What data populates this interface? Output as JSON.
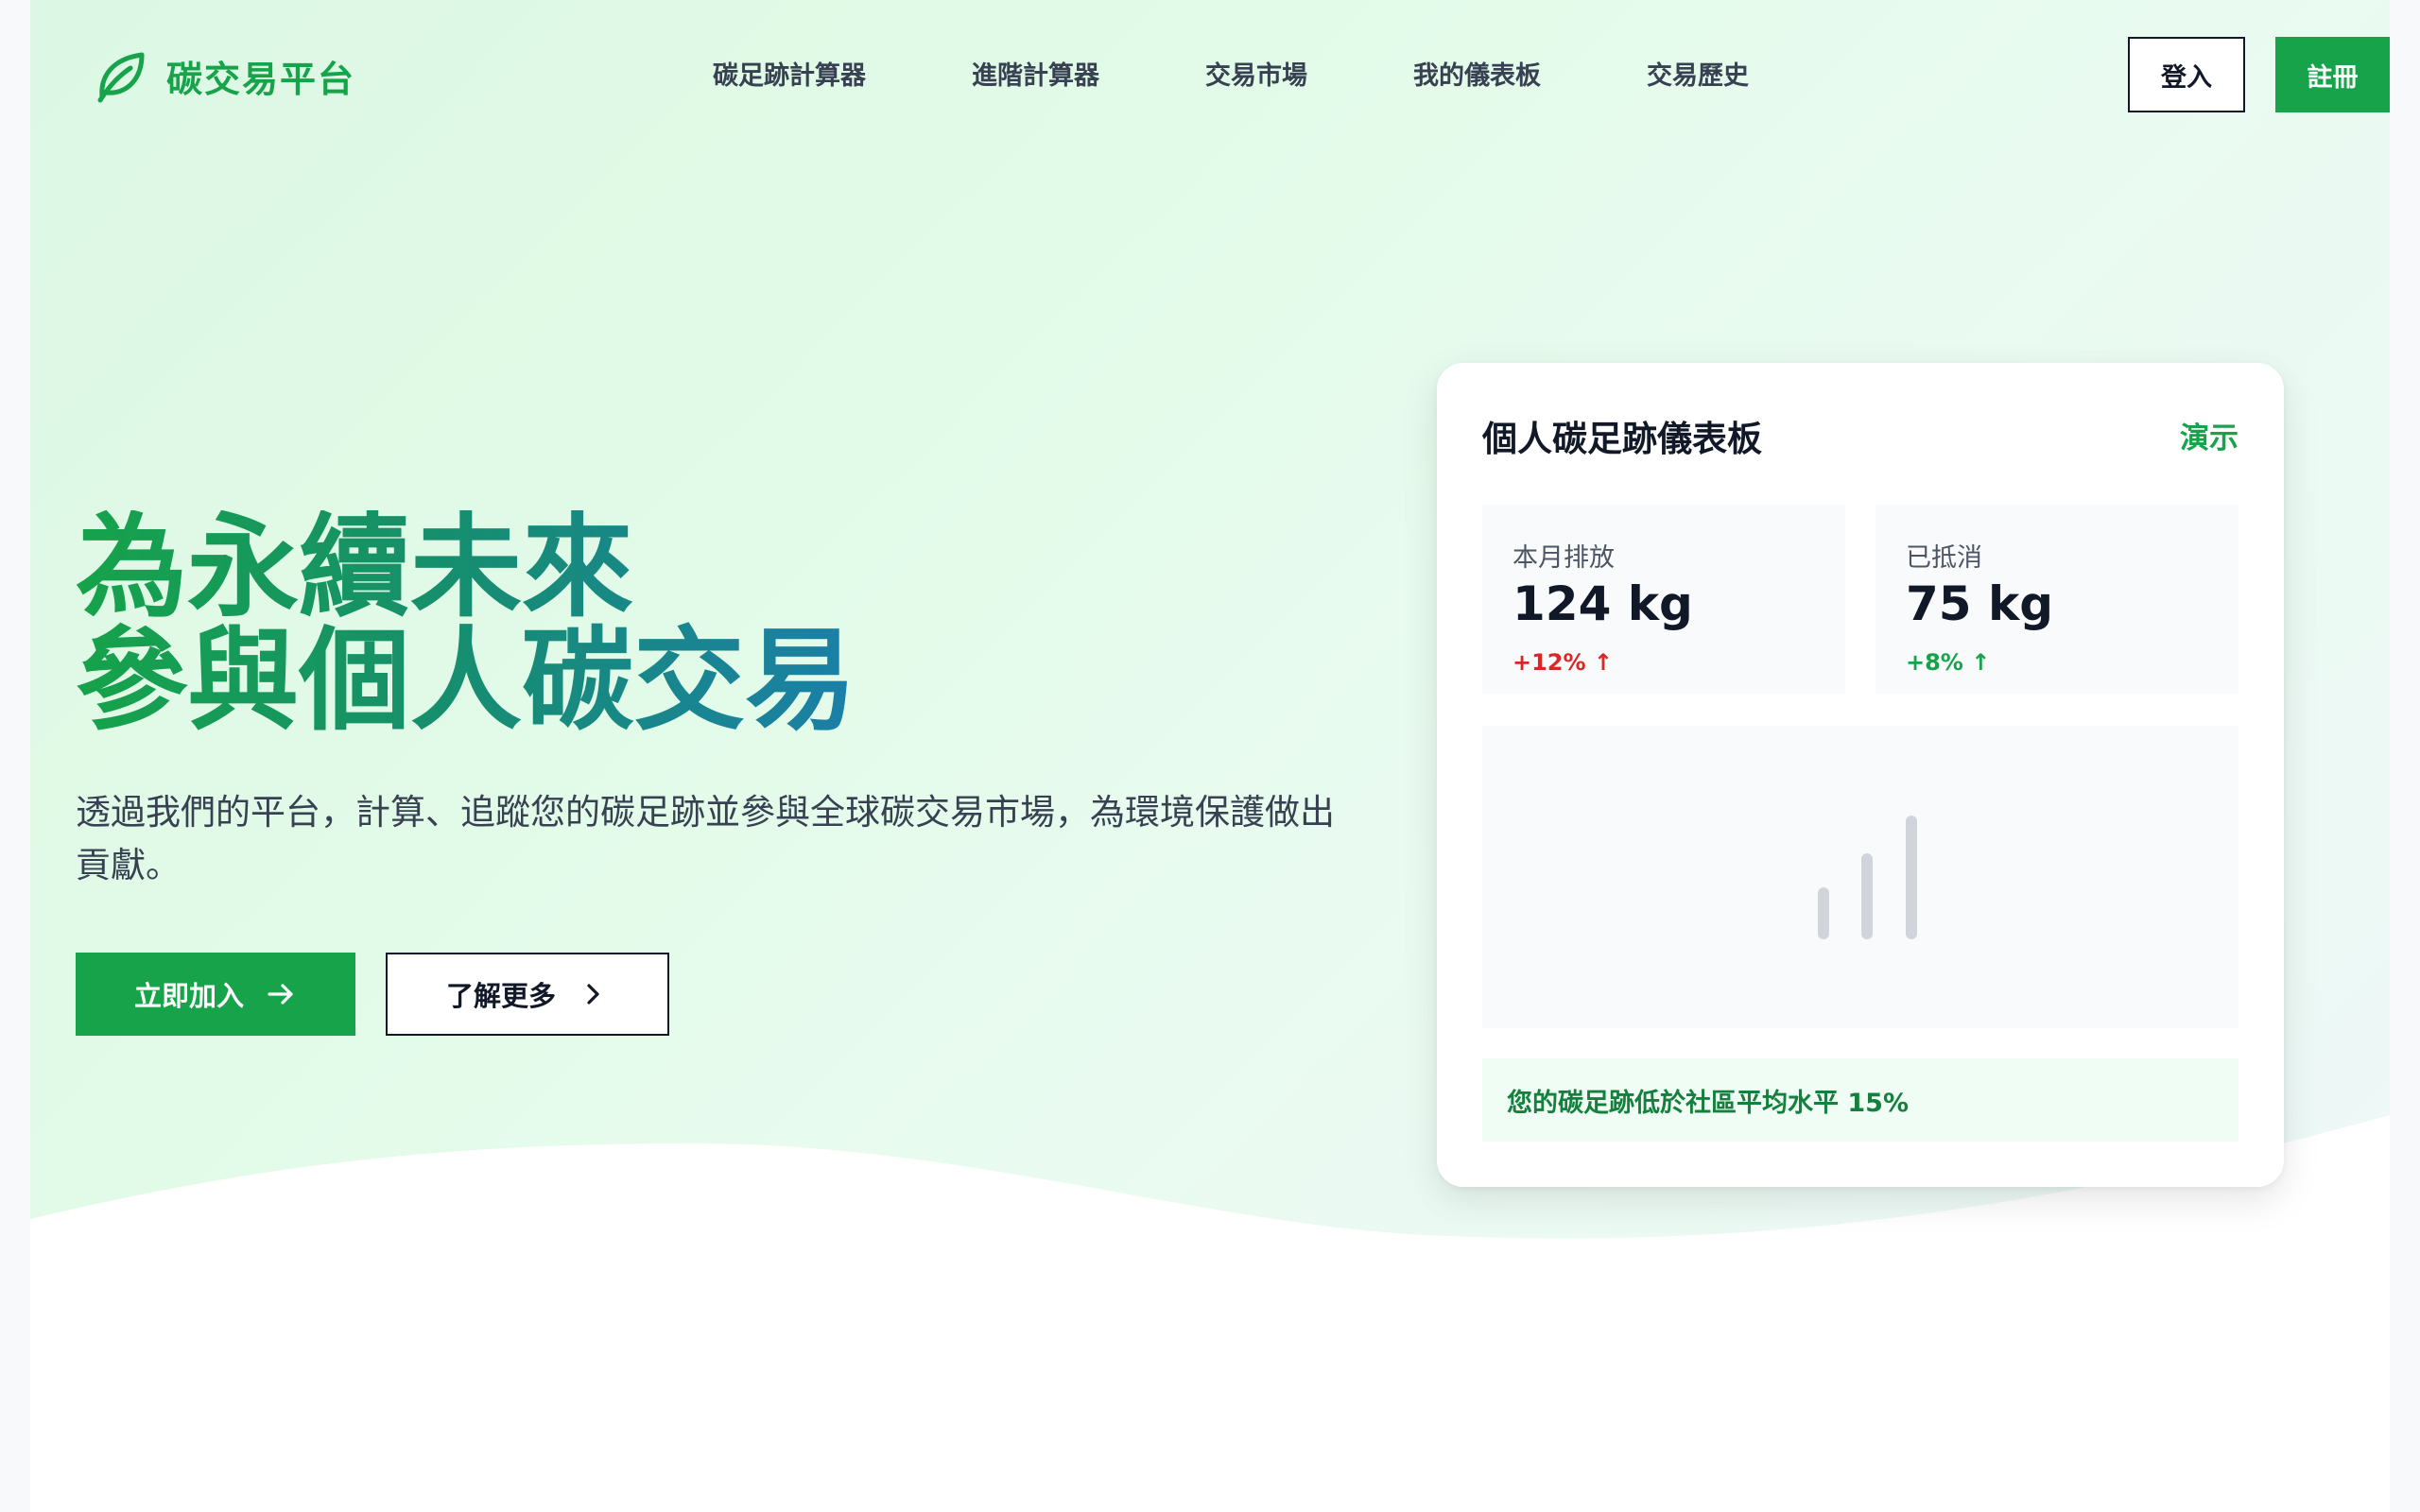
{
  "brand": {
    "name": "碳交易平台",
    "icon": "leaf-icon",
    "accent_color": "#16a34a"
  },
  "nav": {
    "links": [
      {
        "label": "碳足跡計算器"
      },
      {
        "label": "進階計算器"
      },
      {
        "label": "交易市場"
      },
      {
        "label": "我的儀表板"
      },
      {
        "label": "交易歷史"
      }
    ],
    "login_label": "登入",
    "register_label": "註冊"
  },
  "hero": {
    "title_line1": "為永續未來",
    "title_line2": "參與個人碳交易",
    "description": "透過我們的平台，計算、追蹤您的碳足跡並參與全球碳交易市場，為環境保護做出貢獻。",
    "primary_button": {
      "label": "立即加入",
      "icon": "arrow-right-icon"
    },
    "secondary_button": {
      "label": "了解更多",
      "icon": "chevron-right-icon"
    }
  },
  "dashboard": {
    "title": "個人碳足跡儀表板",
    "demo_label": "演示",
    "stats": [
      {
        "label": "本月排放",
        "value": "124 kg",
        "change": "+12% ↑",
        "change_color": "#dc2626"
      },
      {
        "label": "已抵消",
        "value": "75 kg",
        "change": "+8% ↑",
        "change_color": "#16a34a"
      }
    ],
    "chart_placeholder_icon": "bar-chart-icon",
    "note": "您的碳足跡低於社區平均水平 15%"
  }
}
